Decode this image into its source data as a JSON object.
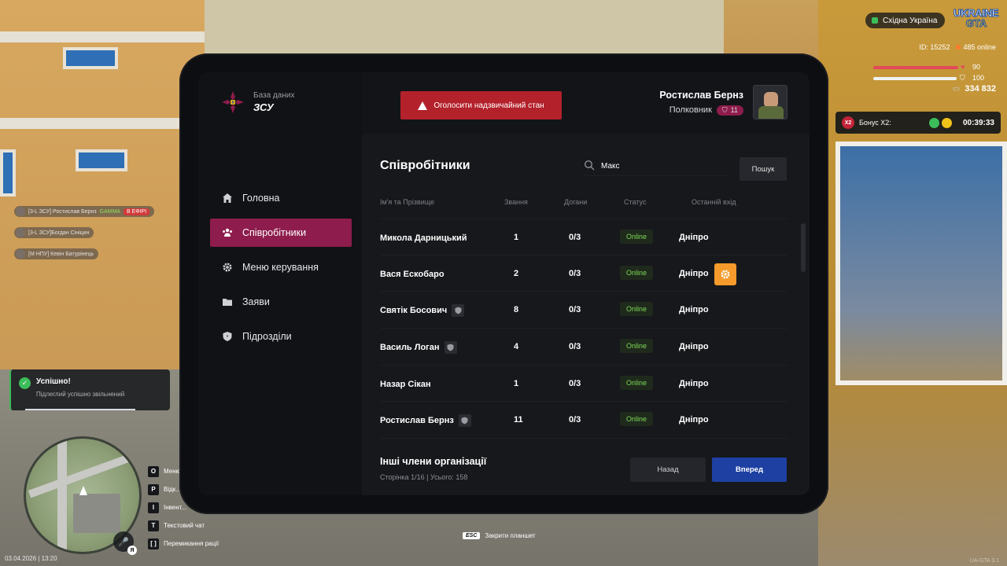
{
  "hud": {
    "region": "Східна Україна",
    "logo_line1": "UKRAINE",
    "logo_line2": "GTA",
    "player_id": "ID: 15252",
    "online": "485 online",
    "health": "90",
    "armor": "100",
    "money": "334 832",
    "bonus_label": "Бонус X2:",
    "bonus_badge": "X2",
    "bonus_timer": "00:39:33",
    "datetime": "03.04.2026 | 13:20",
    "mic_key": "Я",
    "esc_key": "ESC",
    "esc_label": "Закрити планшет",
    "watermark": "UA-GTA 3.1"
  },
  "feed": [
    {
      "name": "[3-L ЗСУ] Ростислав Бернз",
      "tag": "GAMMA",
      "live": "В ЕФІРІ"
    },
    {
      "name": "[3-L ЗСУ]Богдан Сініцин"
    },
    {
      "name": "[M НПУ] Кевін Батурінець"
    }
  ],
  "toast": {
    "title": "Успішно!",
    "message": "Підлеглий успішно звільнений"
  },
  "keys": [
    {
      "key": "O",
      "label": "Меню"
    },
    {
      "key": "P",
      "label": "Відк..."
    },
    {
      "key": "I",
      "label": "Інвент..."
    },
    {
      "key": "T",
      "label": "Текстовий чат"
    },
    {
      "key": "[ ]",
      "label": "Перемикання рації"
    }
  ],
  "tablet": {
    "brand_sub": "База даних",
    "brand_title": "ЗСУ",
    "emergency_label": "Оголосити надзвичайний стан",
    "user": {
      "name": "Ростислав Бернз",
      "rank": "Полковник",
      "rank_level": "11"
    },
    "nav": [
      {
        "label": "Головна",
        "icon": "home-icon"
      },
      {
        "label": "Співробітники",
        "icon": "users-icon",
        "active": true
      },
      {
        "label": "Меню керування",
        "icon": "gear-icon"
      },
      {
        "label": "Заяви",
        "icon": "folder-icon"
      },
      {
        "label": "Підрозділи",
        "icon": "shield-icon"
      }
    ],
    "page_title": "Співробітники",
    "search": {
      "value": "Макс",
      "button": "Пошук"
    },
    "columns": {
      "name": "Ім'я та Прізвище",
      "rank": "Звання",
      "reprimands": "Догани",
      "status": "Статус",
      "last_login": "Останній вхід"
    },
    "employees": [
      {
        "name": "Микола Дарницький",
        "rank": "1",
        "reprimands": "0/3",
        "status": "Online",
        "last": "Дніпро"
      },
      {
        "name": "Вася Ескобаро",
        "rank": "2",
        "reprimands": "0/3",
        "status": "Online",
        "last": "Дніпро"
      },
      {
        "name": "Святік Босович",
        "rank": "8",
        "reprimands": "0/3",
        "status": "Online",
        "last": "Дніпро"
      },
      {
        "name": "Василь Логан",
        "rank": "4",
        "reprimands": "0/3",
        "status": "Online",
        "last": "Дніпро"
      },
      {
        "name": "Назар Сікан",
        "rank": "1",
        "reprimands": "0/3",
        "status": "Online",
        "last": "Дніпро"
      },
      {
        "name": "Ростислав Бернз",
        "rank": "11",
        "reprimands": "0/3",
        "status": "Online",
        "last": "Дніпро"
      }
    ],
    "others_title": "Інші члени організації",
    "others_sub": "Сторінка 1/16 | Усього: 158",
    "back_label": "Назад",
    "next_label": "Вперед"
  },
  "colors": {
    "accent": "#8e1c4d",
    "danger": "#b3212b",
    "primary": "#1e40a3",
    "online": "#7ed957",
    "gear_button": "#f59a2b"
  }
}
